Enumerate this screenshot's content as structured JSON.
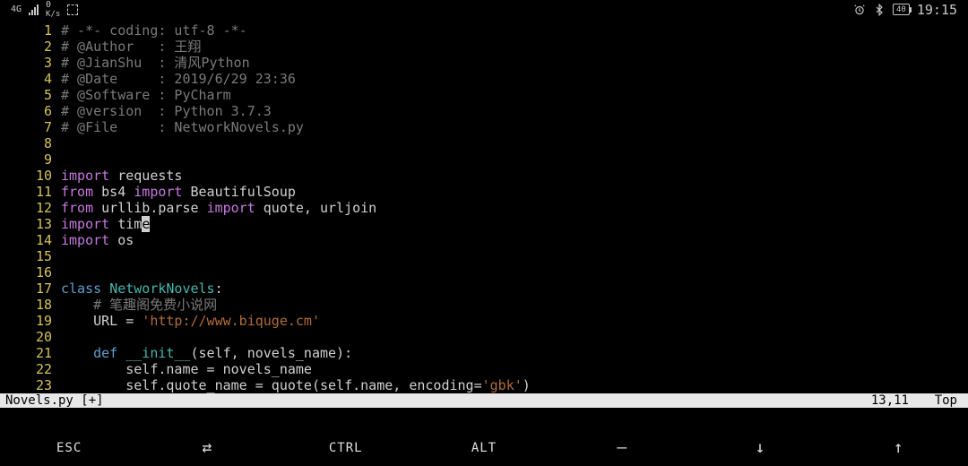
{
  "statusbar": {
    "net_gen": "4G",
    "speed_value": "0",
    "speed_unit": "K/s",
    "battery": "40",
    "time": "19:15"
  },
  "code": {
    "lines": [
      {
        "n": "1",
        "segs": [
          {
            "cls": "c-comment",
            "t": "# -*- coding: utf-8 -*-"
          }
        ]
      },
      {
        "n": "2",
        "segs": [
          {
            "cls": "c-comment",
            "t": "# @Author   : 王翔"
          }
        ]
      },
      {
        "n": "3",
        "segs": [
          {
            "cls": "c-comment",
            "t": "# @JianShu  : 清风Python"
          }
        ]
      },
      {
        "n": "4",
        "segs": [
          {
            "cls": "c-comment",
            "t": "# @Date     : 2019/6/29 23:36"
          }
        ]
      },
      {
        "n": "5",
        "segs": [
          {
            "cls": "c-comment",
            "t": "# @Software : PyCharm"
          }
        ]
      },
      {
        "n": "6",
        "segs": [
          {
            "cls": "c-comment",
            "t": "# @version  : Python 3.7.3"
          }
        ]
      },
      {
        "n": "7",
        "segs": [
          {
            "cls": "c-comment",
            "t": "# @File     : NetworkNovels.py"
          }
        ]
      },
      {
        "n": "8",
        "segs": []
      },
      {
        "n": "9",
        "segs": []
      },
      {
        "n": "10",
        "segs": [
          {
            "cls": "c-import",
            "t": "import"
          },
          {
            "cls": "c-text",
            "t": " requests"
          }
        ]
      },
      {
        "n": "11",
        "segs": [
          {
            "cls": "c-import",
            "t": "from"
          },
          {
            "cls": "c-text",
            "t": " bs4 "
          },
          {
            "cls": "c-import",
            "t": "import"
          },
          {
            "cls": "c-text",
            "t": " BeautifulSoup"
          }
        ]
      },
      {
        "n": "12",
        "segs": [
          {
            "cls": "c-import",
            "t": "from"
          },
          {
            "cls": "c-text",
            "t": " urllib.parse "
          },
          {
            "cls": "c-import",
            "t": "import"
          },
          {
            "cls": "c-text",
            "t": " quote, urljoin"
          }
        ]
      },
      {
        "n": "13",
        "segs": [
          {
            "cls": "c-import",
            "t": "import"
          },
          {
            "cls": "c-text",
            "t": " tim"
          },
          {
            "cls": "cursor",
            "t": "e"
          }
        ]
      },
      {
        "n": "14",
        "segs": [
          {
            "cls": "c-import",
            "t": "import"
          },
          {
            "cls": "c-text",
            "t": " os"
          }
        ]
      },
      {
        "n": "15",
        "segs": []
      },
      {
        "n": "16",
        "segs": []
      },
      {
        "n": "17",
        "segs": [
          {
            "cls": "c-kw",
            "t": "class"
          },
          {
            "cls": "c-text",
            "t": " "
          },
          {
            "cls": "c-class",
            "t": "NetworkNovels"
          },
          {
            "cls": "c-text",
            "t": ":"
          }
        ]
      },
      {
        "n": "18",
        "segs": [
          {
            "cls": "c-text",
            "t": "    "
          },
          {
            "cls": "c-comment",
            "t": "# 笔趣阁免费小说网"
          }
        ]
      },
      {
        "n": "19",
        "segs": [
          {
            "cls": "c-text",
            "t": "    URL = "
          },
          {
            "cls": "c-str",
            "t": "'http://www.biquge.cm'"
          }
        ]
      },
      {
        "n": "20",
        "segs": []
      },
      {
        "n": "21",
        "segs": [
          {
            "cls": "c-text",
            "t": "    "
          },
          {
            "cls": "c-kw",
            "t": "def"
          },
          {
            "cls": "c-text",
            "t": " "
          },
          {
            "cls": "c-func",
            "t": "__init__"
          },
          {
            "cls": "c-text",
            "t": "(self, novels_name):"
          }
        ]
      },
      {
        "n": "22",
        "segs": [
          {
            "cls": "c-text",
            "t": "        self.name = novels_name"
          }
        ]
      },
      {
        "n": "23",
        "segs": [
          {
            "cls": "c-text",
            "t": "        self.quote_name = quote(self.name, encoding="
          },
          {
            "cls": "c-str",
            "t": "'gbk'"
          },
          {
            "cls": "c-text",
            "t": ")"
          }
        ]
      }
    ]
  },
  "vimstatus": {
    "filename": "Novels.py [+]",
    "pos": "13,11",
    "loc": "Top"
  },
  "keys": {
    "esc": "ESC",
    "swap": "⇄",
    "ctrl": "CTRL",
    "alt": "ALT",
    "minus": "—",
    "down": "↓",
    "up": "↑"
  }
}
